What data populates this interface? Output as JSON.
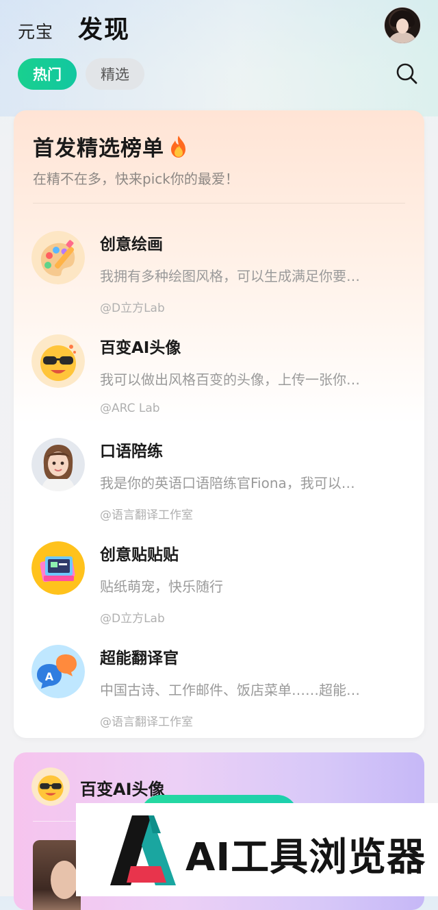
{
  "header": {
    "brand": "元宝",
    "title": "发现"
  },
  "tabs": [
    {
      "label": "热门",
      "active": true
    },
    {
      "label": "精选",
      "active": false
    }
  ],
  "ranking": {
    "title": "首发精选榜单",
    "subtitle": "在精不在多，快来pick你的最爱！",
    "items": [
      {
        "name": "创意绘画",
        "desc": "我拥有多种绘图风格，可以生成满足你要…",
        "author": "@D立方Lab",
        "icon": "palette-icon"
      },
      {
        "name": "百变AI头像",
        "desc": "我可以做出风格百变的头像，上传一张你…",
        "author": "@ARC Lab",
        "icon": "sunglasses-emoji-icon"
      },
      {
        "name": "口语陪练",
        "desc": "我是你的英语口语陪练官Fiona，我可以…",
        "author": "@语言翻译工作室",
        "icon": "tutor-avatar-icon"
      },
      {
        "name": "创意贴贴贴",
        "desc": "贴纸萌宠，快乐随行",
        "author": "@D立方Lab",
        "icon": "sticker-camera-icon"
      },
      {
        "name": "超能翻译官",
        "desc": "中国古诗、工作邮件、饭店菜单……超能…",
        "author": "@语言翻译工作室",
        "icon": "translate-bubbles-icon"
      }
    ]
  },
  "avatar_card": {
    "title": "百变AI头像"
  },
  "watermark": {
    "text": "AI工具浏览器"
  },
  "colors": {
    "accent_green": "#19d08f",
    "tab_inactive_bg": "#e2e5e8",
    "rank_card_top": "#ffe4d5",
    "avatar_card_pink": "#f6c4ee",
    "avatar_card_purple": "#c6b8f7"
  }
}
